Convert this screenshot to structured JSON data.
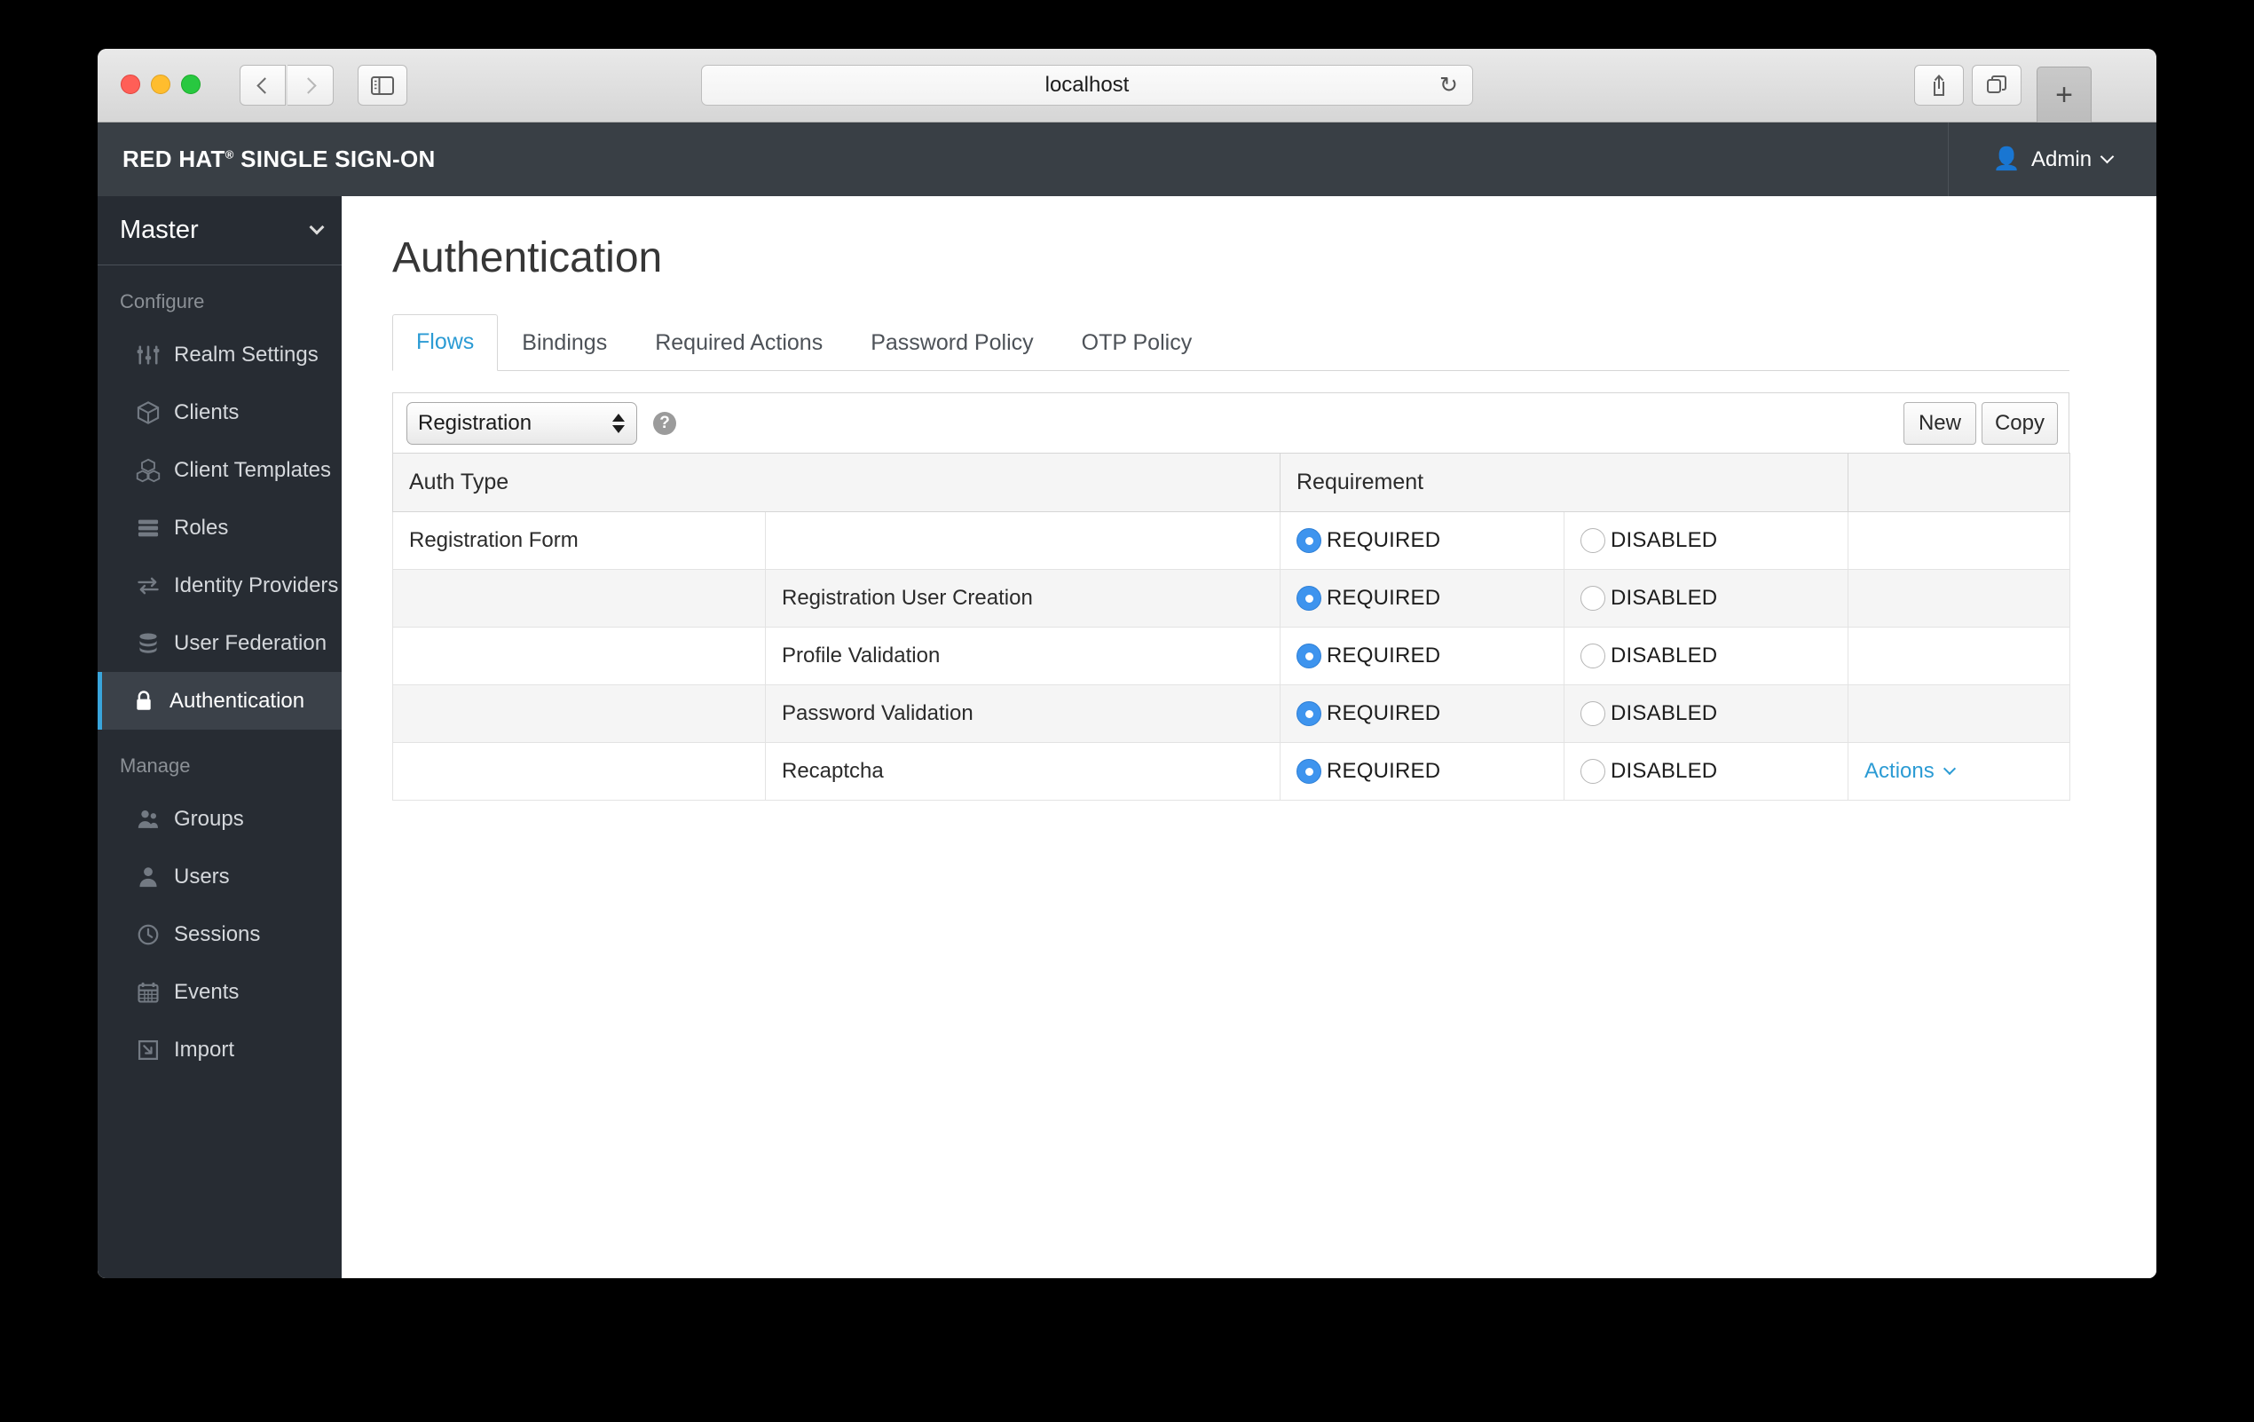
{
  "browser": {
    "url": "localhost",
    "reload_icon": "reload-icon",
    "back_icon": "chevron-left-icon",
    "forward_icon": "chevron-right-icon",
    "sidebar_icon": "sidebar-toggle-icon",
    "share_icon": "share-icon",
    "tabs_icon": "tab-overview-icon",
    "new_tab_label": "+"
  },
  "header": {
    "brand_bold": "RED HAT",
    "brand_reg": "®",
    "brand_rest": "SINGLE SIGN-ON",
    "user_name": "Admin",
    "user_icon": "user-icon"
  },
  "sidebar": {
    "realm": "Master",
    "sections": [
      {
        "title": "Configure",
        "items": [
          {
            "label": "Realm Settings",
            "icon": "sliders-icon",
            "active": false
          },
          {
            "label": "Clients",
            "icon": "cube-icon",
            "active": false
          },
          {
            "label": "Client Templates",
            "icon": "cubes-icon",
            "active": false
          },
          {
            "label": "Roles",
            "icon": "layers-icon",
            "active": false
          },
          {
            "label": "Identity Providers",
            "icon": "exchange-icon",
            "active": false
          },
          {
            "label": "User Federation",
            "icon": "database-icon",
            "active": false
          },
          {
            "label": "Authentication",
            "icon": "lock-icon",
            "active": true
          }
        ]
      },
      {
        "title": "Manage",
        "items": [
          {
            "label": "Groups",
            "icon": "group-icon",
            "active": false
          },
          {
            "label": "Users",
            "icon": "user-icon",
            "active": false
          },
          {
            "label": "Sessions",
            "icon": "clock-icon",
            "active": false
          },
          {
            "label": "Events",
            "icon": "calendar-icon",
            "active": false
          },
          {
            "label": "Import",
            "icon": "import-icon",
            "active": false
          }
        ]
      }
    ]
  },
  "main": {
    "page_title": "Authentication",
    "tabs": [
      {
        "label": "Flows",
        "active": true
      },
      {
        "label": "Bindings",
        "active": false
      },
      {
        "label": "Required Actions",
        "active": false
      },
      {
        "label": "Password Policy",
        "active": false
      },
      {
        "label": "OTP Policy",
        "active": false
      }
    ],
    "toolbar": {
      "selected_flow": "Registration",
      "flow_options": [
        "Registration"
      ],
      "help_icon": "help-circle-icon",
      "help_glyph": "?",
      "new_label": "New",
      "copy_label": "Copy"
    },
    "table": {
      "headers": [
        "Auth Type",
        "",
        "Requirement",
        "",
        ""
      ],
      "rows": [
        {
          "auth_type": "Registration Form",
          "sub_type": "",
          "required_label": "REQUIRED",
          "required_selected": true,
          "disabled_label": "DISABLED",
          "disabled_selected": false,
          "actions_label": "",
          "has_actions": false,
          "stripe": false
        },
        {
          "auth_type": "",
          "sub_type": "Registration User Creation",
          "required_label": "REQUIRED",
          "required_selected": true,
          "disabled_label": "DISABLED",
          "disabled_selected": false,
          "actions_label": "",
          "has_actions": false,
          "stripe": true
        },
        {
          "auth_type": "",
          "sub_type": "Profile Validation",
          "required_label": "REQUIRED",
          "required_selected": true,
          "disabled_label": "DISABLED",
          "disabled_selected": false,
          "actions_label": "",
          "has_actions": false,
          "stripe": false
        },
        {
          "auth_type": "",
          "sub_type": "Password Validation",
          "required_label": "REQUIRED",
          "required_selected": true,
          "disabled_label": "DISABLED",
          "disabled_selected": false,
          "actions_label": "",
          "has_actions": false,
          "stripe": true
        },
        {
          "auth_type": "",
          "sub_type": "Recaptcha",
          "required_label": "REQUIRED",
          "required_selected": true,
          "disabled_label": "DISABLED",
          "disabled_selected": false,
          "actions_label": "Actions",
          "has_actions": true,
          "stripe": false
        }
      ]
    }
  },
  "colors": {
    "header_bg": "#393f45",
    "sidebar_bg": "#272c33",
    "accent_blue": "#2b9bd4",
    "active_bar": "#39a5dc",
    "radio_on": "#3e94ee"
  }
}
